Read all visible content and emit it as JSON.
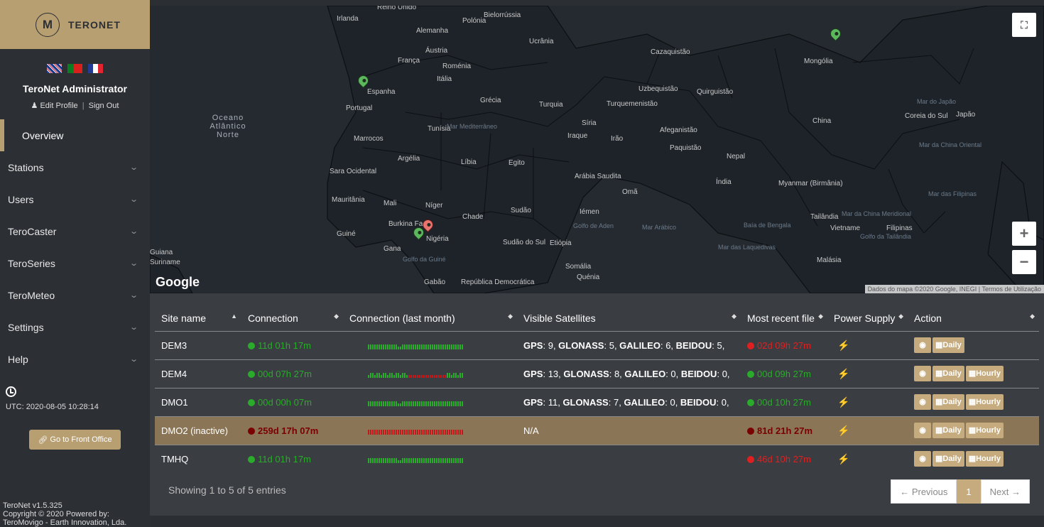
{
  "brand": {
    "name": "TERONET",
    "logo_glyph": "M"
  },
  "user": {
    "name": "TeroNet Administrator",
    "edit_profile": "Edit Profile",
    "separator": "|",
    "sign_out": "Sign Out"
  },
  "nav": [
    {
      "label": "Overview",
      "active": true
    },
    {
      "label": "Stations"
    },
    {
      "label": "Users"
    },
    {
      "label": "TeroCaster"
    },
    {
      "label": "TeroSeries"
    },
    {
      "label": "TeroMeteo"
    },
    {
      "label": "Settings"
    },
    {
      "label": "Help"
    }
  ],
  "clock": {
    "utc": "UTC: 2020-08-05 10:28:14"
  },
  "front_office": {
    "label": "Go to Front Office",
    "icon": "link-icon"
  },
  "footer": {
    "version": "TeroNet v1.5.325",
    "copyright": "Copyright © 2020 Powered by:",
    "company": "TeroMovigo - Earth Innovation, Lda."
  },
  "map": {
    "google": "Google",
    "credit": "Dados do mapa ©2020 Google, INEGI | Termos de Utilização",
    "zoom_in": "+",
    "zoom_out": "−",
    "labels": [
      "Reino Unido",
      "Irlanda",
      "Bielorrússia",
      "Polónia",
      "Alemanha",
      "Ucrânia",
      "Áustria",
      "França",
      "Roménia",
      "Itália",
      "Espanha",
      "Portugal",
      "Grécia",
      "Turquia",
      "Marrocos",
      "Tunísia",
      "Mar Mediterrâneo",
      "Síria",
      "Iraque",
      "Irão",
      "Argélia",
      "Líbia",
      "Egito",
      "Arábia Saudita",
      "Omã",
      "Cazaquistão",
      "Uzbequistão",
      "Quirguistão",
      "Turquemenistão",
      "Afeganistão",
      "Paquistão",
      "Nepal",
      "Índia",
      "China",
      "Mongólia",
      "Mar do Japão",
      "Coreia do Sul",
      "Japão",
      "Mar da China Oriental",
      "Mauritânia",
      "Mali",
      "Níger",
      "Chade",
      "Sudão",
      "Iémen",
      "Golfo de Aden",
      "Mar Arábico",
      "Baía de Bengala",
      "Myanmar (Birmânia)",
      "Tailândia",
      "Mar da China Meridional",
      "Vietname",
      "Filipinas",
      "Mar das Filipinas",
      "Sara Ocidental",
      "Burkina Faso",
      "Guiné",
      "Gana",
      "Nigéria",
      "Sudão do Sul",
      "Etiópia",
      "Somália",
      "Quénia",
      "Gabão",
      "República Democrática",
      "Golfo da Guiné",
      "Golfo da Tailândia",
      "Mar das Laquedivas",
      "Malásia",
      "Oceano Atlântico Norte",
      "Guiana",
      "Suriname"
    ]
  },
  "table": {
    "columns": [
      "Site name",
      "Connection",
      "Connection (last month)",
      "Visible Satellites",
      "Most recent file",
      "Power Supply",
      "Action"
    ],
    "rows": [
      {
        "site": "DEM3",
        "connection": "11d 01h 17m",
        "conn_status": "good",
        "spark": "good",
        "satellites": [
          [
            "GPS",
            "9"
          ],
          [
            "GLONASS",
            "5"
          ],
          [
            "GALILEO",
            "6"
          ],
          [
            "BEIDOU",
            "5"
          ]
        ],
        "recent": "02d 09h 27m",
        "recent_status": "bad",
        "power": "ok",
        "actions": [
          "view",
          "Daily"
        ]
      },
      {
        "site": "DEM4",
        "connection": "00d 07h 27m",
        "conn_status": "good",
        "spark": "mixed",
        "satellites": [
          [
            "GPS",
            "13"
          ],
          [
            "GLONASS",
            "8"
          ],
          [
            "GALILEO",
            "0"
          ],
          [
            "BEIDOU",
            "0"
          ]
        ],
        "recent": "00d 09h 27m",
        "recent_status": "good",
        "power": "ok",
        "actions": [
          "view",
          "Daily",
          "Hourly"
        ]
      },
      {
        "site": "DMO1",
        "connection": "00d 00h 07m",
        "conn_status": "good",
        "spark": "good",
        "satellites": [
          [
            "GPS",
            "11"
          ],
          [
            "GLONASS",
            "7"
          ],
          [
            "GALILEO",
            "0"
          ],
          [
            "BEIDOU",
            "0"
          ]
        ],
        "recent": "00d 10h 27m",
        "recent_status": "good",
        "power": "ok",
        "actions": [
          "view",
          "Daily",
          "Hourly"
        ]
      },
      {
        "site": "DMO2 (inactive)",
        "connection": "259d 17h 07m",
        "conn_status": "bad",
        "spark": "bad",
        "satellites_text": "N/A",
        "recent": "81d 21h 27m",
        "recent_status": "bad",
        "power": "fail",
        "actions": [
          "view",
          "Daily",
          "Hourly"
        ],
        "inactive": true
      },
      {
        "site": "TMHQ",
        "connection": "11d 01h 17m",
        "conn_status": "good",
        "spark": "good",
        "satellites_text": "",
        "recent": "46d 10h 27m",
        "recent_status": "bad",
        "power": "ok",
        "actions": [
          "view",
          "Daily",
          "Hourly"
        ]
      }
    ],
    "showing": "Showing 1 to 5 of 5 entries",
    "pager": {
      "previous": "← Previous",
      "current": "1",
      "next": "Next →"
    }
  },
  "colors": {
    "gold": "#b89f72",
    "sidebar": "#2c2f34",
    "good": "#2bab2b",
    "bad": "#e02020"
  }
}
